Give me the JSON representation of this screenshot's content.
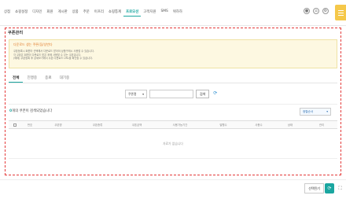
{
  "nav": {
    "menu": [
      "상점",
      "쇼핑설정",
      "디자인",
      "회원",
      "게시판",
      "상품",
      "주문",
      "이프리",
      "쇼핑통계",
      "프로모션",
      "고객지원",
      "SMS",
      "위하하"
    ],
    "active_index": 9,
    "icons": [
      "user-icon",
      "home-icon",
      "settings-icon"
    ]
  },
  "page": {
    "title": "쿠폰관리",
    "notice": {
      "title": "다운로드 생는 쿠폰(집/상번다",
      "lines": [
        "쿠폰등록시 회원이 선택해서 다운로드 받아야 상품구매시 사용할 수 있습니다.",
        "각 쿠폰은 회원이 다운로드 받은 후에 사용할 수 있는 쿠폰입니다.",
        "(예제) 쿠폰등록 후 상세보기에서 쿠폰 다운로드 URL을 확인할 수 있습니다."
      ]
    },
    "tabs": [
      "전체",
      "진행중",
      "종료",
      "대기중"
    ],
    "active_tab": 0,
    "search": {
      "select_value": "쿠폰명",
      "input_placeholder": "",
      "button_label": "검색"
    },
    "result_prefix": "0",
    "result_text": "개의 쿠폰이 검색되었습니다",
    "sort_value": "정렬순서",
    "table": {
      "headers": [
        "번호",
        "쿠폰명",
        "쿠폰종류",
        "쿠폰금액",
        "사용가능기간",
        "발행수",
        "사용수",
        "상태",
        "관리"
      ],
      "empty_text": "자료가 없습니다"
    }
  },
  "bottom": {
    "button_label": "선택된기"
  }
}
